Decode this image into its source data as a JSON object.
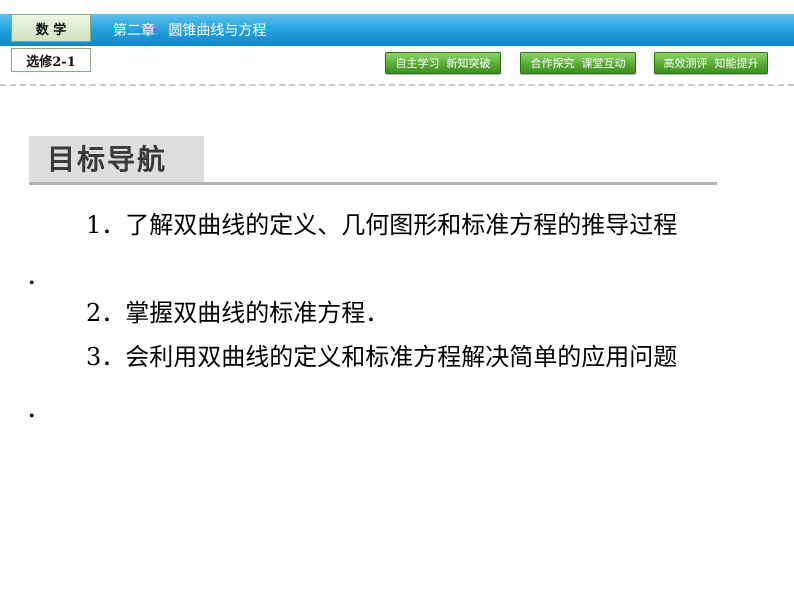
{
  "header": {
    "subject": "数 学",
    "chapter": "第二章   圆锥曲线与方程",
    "module": "选修2-1",
    "nav_buttons": [
      "自主学习  新知突破",
      "合作探究  课堂互动",
      "高效测评  知能提升"
    ]
  },
  "section": {
    "title": "目标导航"
  },
  "goals": [
    "1．了解双曲线的定义、几何图形和标准方程的推导过程",
    "．",
    "2．掌握双曲线的标准方程．",
    "3．会利用双曲线的定义和标准方程解决简单的应用问题",
    "．"
  ],
  "colors": {
    "header_blue": "#29a3df",
    "nav_green": "#56a832",
    "section_gray": "#dedede"
  }
}
